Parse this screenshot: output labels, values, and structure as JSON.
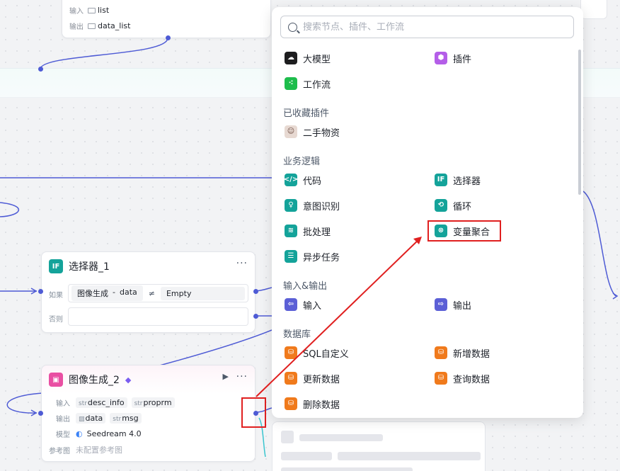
{
  "top_node": {
    "input_label": "输入",
    "input_value": "list",
    "output_label": "输出",
    "output_value": "data_list"
  },
  "selector_node": {
    "title": "选择器_1",
    "icon_text": "IF",
    "more": "···",
    "if_label": "如果",
    "if_left_chip": "图像生成",
    "if_left_sep": "-",
    "if_left_field": "data",
    "operator": "≠",
    "if_right_value": "Empty",
    "else_label": "否则"
  },
  "image_node": {
    "title": "图像生成_2",
    "run": "▶",
    "more": "···",
    "input_label": "输入",
    "inputs": [
      {
        "type": "str",
        "name": "desc_info"
      },
      {
        "type": "str",
        "name": "proprm"
      }
    ],
    "output_label": "输出",
    "outputs": [
      {
        "type": "img",
        "name": "data"
      },
      {
        "type": "str",
        "name": "msg"
      }
    ],
    "model_label": "模型",
    "model_value": "Seedream 4.0",
    "ref_label": "参考图",
    "ref_value": "未配置参考图"
  },
  "panel": {
    "search_placeholder": "搜索节点、插件、工作流",
    "top_items": [
      {
        "label": "大模型",
        "icon": "llm-icon"
      },
      {
        "label": "插件",
        "icon": "plugin-icon"
      },
      {
        "label": "工作流",
        "icon": "workflow-icon"
      }
    ],
    "favorites_title": "已收藏插件",
    "favorites": [
      {
        "label": "二手物资",
        "icon": "avatar-icon"
      }
    ],
    "logic_title": "业务逻辑",
    "logic_items": [
      {
        "label": "代码",
        "icon": "code-icon"
      },
      {
        "label": "选择器",
        "icon": "if-icon"
      },
      {
        "label": "意图识别",
        "icon": "intent-icon"
      },
      {
        "label": "循环",
        "icon": "loop-icon"
      },
      {
        "label": "批处理",
        "icon": "batch-icon"
      },
      {
        "label": "变量聚合",
        "icon": "aggregate-icon"
      },
      {
        "label": "异步任务",
        "icon": "async-icon"
      }
    ],
    "io_title": "输入&输出",
    "io_items": [
      {
        "label": "输入",
        "icon": "input-icon"
      },
      {
        "label": "输出",
        "icon": "output-icon"
      }
    ],
    "db_title": "数据库",
    "db_items": [
      {
        "label": "SQL自定义",
        "icon": "sql-icon"
      },
      {
        "label": "新增数据",
        "icon": "add-data-icon"
      },
      {
        "label": "更新数据",
        "icon": "update-data-icon"
      },
      {
        "label": "查询数据",
        "icon": "query-data-icon"
      },
      {
        "label": "删除数据",
        "icon": "delete-data-icon"
      }
    ]
  },
  "colors": {
    "accent": "#4e5bd5",
    "annotation_red": "#e02020",
    "teal": "#14a39a",
    "orange": "#f07a1c"
  }
}
